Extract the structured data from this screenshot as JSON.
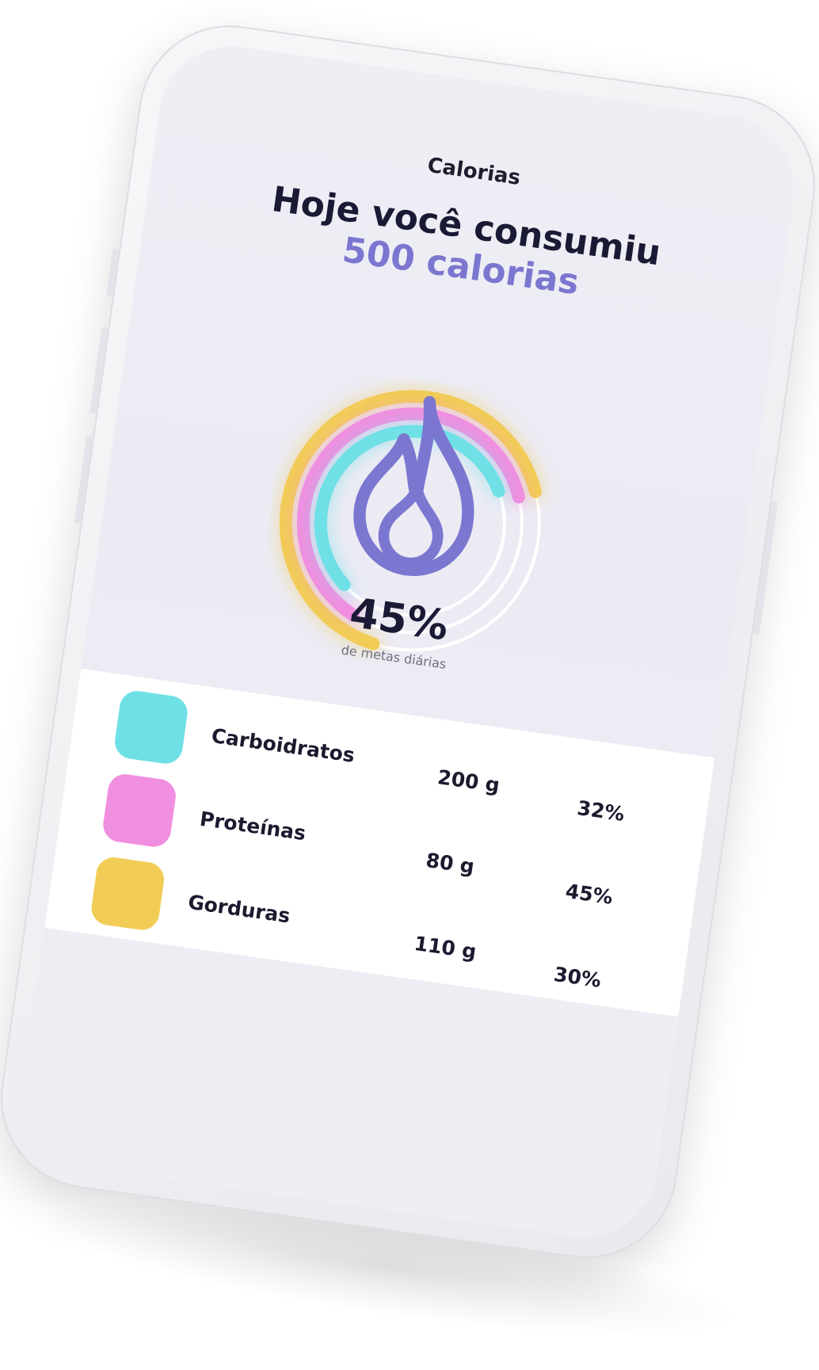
{
  "header": {
    "title": "Calorias",
    "headline_line1": "Hoje você consumiu",
    "headline_line2": "500 calorias"
  },
  "summary": {
    "percent": "45%",
    "caption": "de metas diárias",
    "icon": "flame-icon"
  },
  "colors": {
    "carbs": "#6fe0e6",
    "protein": "#f08fe0",
    "fat": "#f2cd56",
    "accent": "#7b77d0",
    "track": "#ffffff"
  },
  "macros": [
    {
      "label": "Carboidratos",
      "grams": "200 g",
      "percent": "32%",
      "fraction": 0.32
    },
    {
      "label": "Proteínas",
      "grams": "80 g",
      "percent": "45%",
      "fraction": 0.45
    },
    {
      "label": "Gorduras",
      "grams": "110 g",
      "percent": "30%",
      "fraction": 0.3
    }
  ]
}
